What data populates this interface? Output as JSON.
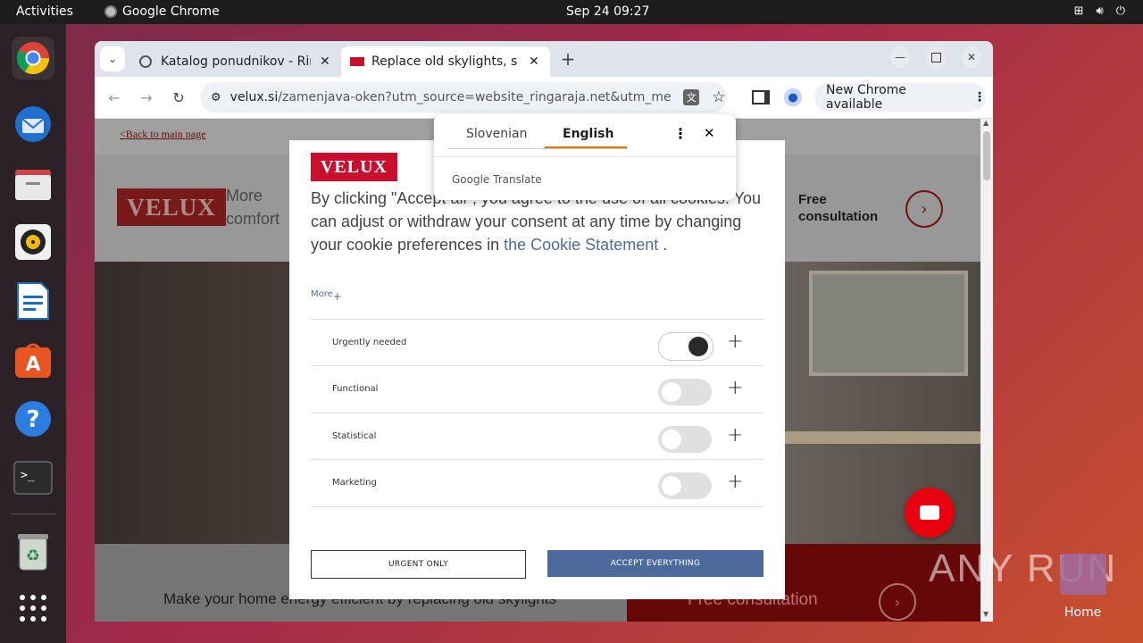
{
  "desktop": {
    "activities": "Activities",
    "app_name": "Google Chrome",
    "clock": "Sep 24  09:27",
    "home_label": "Home",
    "watermark": "ANY RUN"
  },
  "dock": {
    "items": [
      "chrome-icon",
      "thunderbird-icon",
      "files-icon",
      "rhythmbox-icon",
      "writer-icon",
      "app-center-icon",
      "help-icon",
      "terminal-icon",
      "trash-icon",
      "apps-grid-icon"
    ]
  },
  "browser": {
    "tabs": [
      {
        "title": "Katalog ponudnikov - Rin"
      },
      {
        "title": "Replace old skylights, sa"
      }
    ],
    "url_host": "velux.si",
    "url_path": "/zamenjava-oken?utm_source=website_ringaraja.net&utm_medium...",
    "update_button": "New Chrome available"
  },
  "translate": {
    "source_lang": "Slovenian",
    "target_lang": "English",
    "brand": "Google Translate"
  },
  "page": {
    "back_link": "<Back to main page",
    "logo_text": "VELUX",
    "header_tagline_1": "More",
    "header_tagline_2": "comfort",
    "free_consult_1": "Free",
    "free_consult_2": "consultation",
    "bottom_left_text": "Make your home energy efficient by replacing old skylights",
    "bottom_right_text": "Free consultation"
  },
  "cookie": {
    "logo_text": "VELUX",
    "intro": "By clicking \"Accept all\", you agree to the use of all cookies. You can adjust or withdraw your consent at any time by changing your cookie preferences in ",
    "link_text": "the Cookie Statement",
    "intro_end": " .",
    "more": "More",
    "categories": [
      {
        "label": "Urgently needed",
        "enabled": true
      },
      {
        "label": "Functional",
        "enabled": false
      },
      {
        "label": "Statistical",
        "enabled": false
      },
      {
        "label": "Marketing",
        "enabled": false
      }
    ],
    "btn_urgent": "URGENT ONLY",
    "btn_accept": "ACCEPT EVERYTHING"
  },
  "colors": {
    "velux_red": "#c8102e",
    "accent_blue": "#4b6a9b",
    "link_blue": "#4e6d9c",
    "chat_red": "#e8000f",
    "translate_orange": "#e37400"
  }
}
